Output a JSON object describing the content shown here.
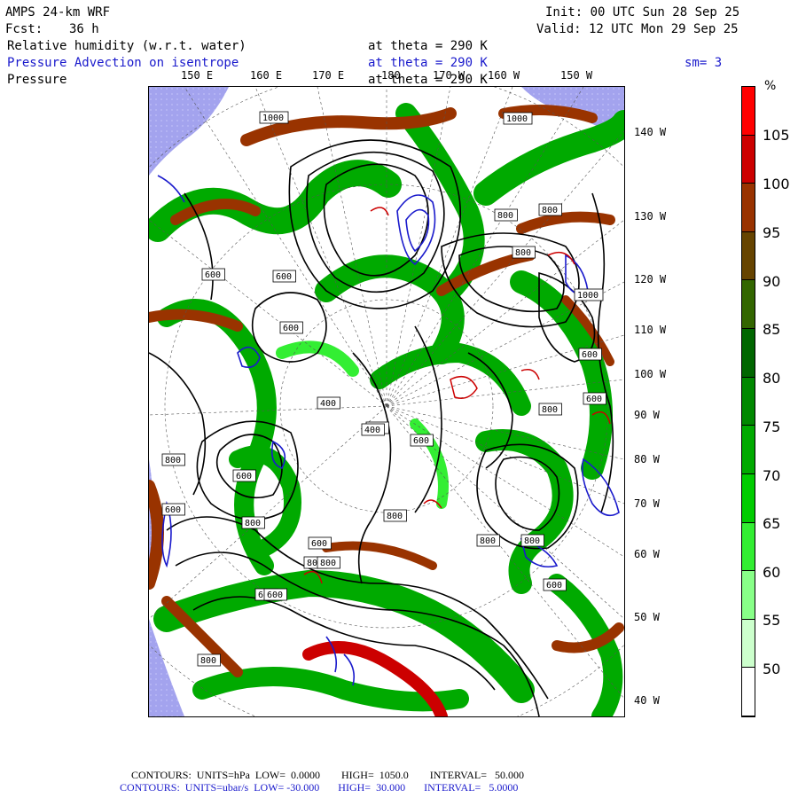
{
  "header": {
    "model": "AMPS 24-km WRF",
    "init": "Init: 00 UTC Sun 28 Sep 25",
    "fcst_label": "Fcst:",
    "fcst_value": "36 h",
    "valid": "Valid: 12 UTC Mon 29 Sep 25",
    "field1": "Relative humidity (w.r.t. water)",
    "field1_level": "at theta = 290 K",
    "field2": "Pressure Advection on isentrope",
    "field2_level": "at theta = 290 K",
    "field2_smooth": "sm= 3",
    "field3": "Pressure",
    "field3_level": "at theta = 290 K"
  },
  "map": {
    "top_longitudes": [
      "150 E",
      "160 E",
      "170 E",
      "180",
      "170 W",
      "160 W",
      "150 W"
    ],
    "right_longitudes": [
      "140 W",
      "130 W",
      "120 W",
      "110 W",
      "100 W",
      "90 W",
      "80 W",
      "70 W",
      "60 W",
      "50 W",
      "40 W"
    ],
    "pressure_labels": [
      "1000",
      "800",
      "800",
      "800",
      "600",
      "600",
      "600",
      "400",
      "400",
      "600",
      "800",
      "800",
      "600",
      "800",
      "600",
      "1000",
      "800",
      "600",
      "1000",
      "600",
      "800",
      "600",
      "800",
      "600",
      "600",
      "800",
      "800",
      "400",
      "600",
      "800"
    ]
  },
  "colorbar": {
    "unit": "%",
    "labels": [
      "105",
      "100",
      "95",
      "90",
      "85",
      "80",
      "75",
      "70",
      "65",
      "60",
      "55",
      "50"
    ],
    "colors": [
      "#ff0000",
      "#cc0000",
      "#993300",
      "#664400",
      "#336600",
      "#006600",
      "#008800",
      "#00aa00",
      "#00cc00",
      "#33ee33",
      "#88ff88",
      "#ccffcc",
      "#ffffff"
    ]
  },
  "footer": {
    "line1": "CONTOURS:  UNITS=hPa  LOW=  0.0000        HIGH=  1050.0        INTERVAL=   50.000",
    "line2": "CONTOURS:  UNITS=ubar/s  LOW= -30.000       HIGH=  30.000       INTERVAL=   5.0000"
  },
  "colors": {
    "contour_black": "#000000",
    "advection_blue": "#1a1acc",
    "advection_red": "#cc0000",
    "ocean": "#9999ee"
  }
}
